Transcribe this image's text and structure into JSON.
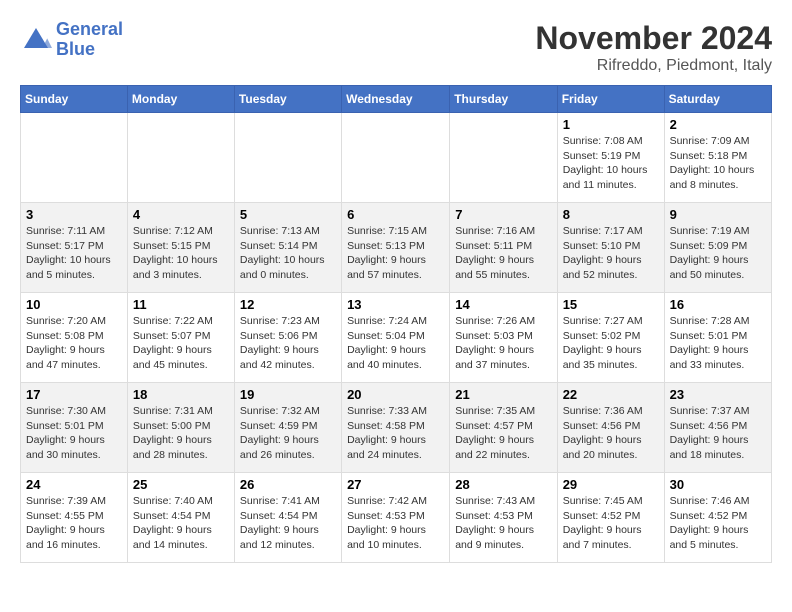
{
  "logo": {
    "line1": "General",
    "line2": "Blue"
  },
  "title": "November 2024",
  "subtitle": "Rifreddo, Piedmont, Italy",
  "days_of_week": [
    "Sunday",
    "Monday",
    "Tuesday",
    "Wednesday",
    "Thursday",
    "Friday",
    "Saturday"
  ],
  "weeks": [
    [
      {
        "day": "",
        "info": ""
      },
      {
        "day": "",
        "info": ""
      },
      {
        "day": "",
        "info": ""
      },
      {
        "day": "",
        "info": ""
      },
      {
        "day": "",
        "info": ""
      },
      {
        "day": "1",
        "info": "Sunrise: 7:08 AM\nSunset: 5:19 PM\nDaylight: 10 hours and 11 minutes."
      },
      {
        "day": "2",
        "info": "Sunrise: 7:09 AM\nSunset: 5:18 PM\nDaylight: 10 hours and 8 minutes."
      }
    ],
    [
      {
        "day": "3",
        "info": "Sunrise: 7:11 AM\nSunset: 5:17 PM\nDaylight: 10 hours and 5 minutes."
      },
      {
        "day": "4",
        "info": "Sunrise: 7:12 AM\nSunset: 5:15 PM\nDaylight: 10 hours and 3 minutes."
      },
      {
        "day": "5",
        "info": "Sunrise: 7:13 AM\nSunset: 5:14 PM\nDaylight: 10 hours and 0 minutes."
      },
      {
        "day": "6",
        "info": "Sunrise: 7:15 AM\nSunset: 5:13 PM\nDaylight: 9 hours and 57 minutes."
      },
      {
        "day": "7",
        "info": "Sunrise: 7:16 AM\nSunset: 5:11 PM\nDaylight: 9 hours and 55 minutes."
      },
      {
        "day": "8",
        "info": "Sunrise: 7:17 AM\nSunset: 5:10 PM\nDaylight: 9 hours and 52 minutes."
      },
      {
        "day": "9",
        "info": "Sunrise: 7:19 AM\nSunset: 5:09 PM\nDaylight: 9 hours and 50 minutes."
      }
    ],
    [
      {
        "day": "10",
        "info": "Sunrise: 7:20 AM\nSunset: 5:08 PM\nDaylight: 9 hours and 47 minutes."
      },
      {
        "day": "11",
        "info": "Sunrise: 7:22 AM\nSunset: 5:07 PM\nDaylight: 9 hours and 45 minutes."
      },
      {
        "day": "12",
        "info": "Sunrise: 7:23 AM\nSunset: 5:06 PM\nDaylight: 9 hours and 42 minutes."
      },
      {
        "day": "13",
        "info": "Sunrise: 7:24 AM\nSunset: 5:04 PM\nDaylight: 9 hours and 40 minutes."
      },
      {
        "day": "14",
        "info": "Sunrise: 7:26 AM\nSunset: 5:03 PM\nDaylight: 9 hours and 37 minutes."
      },
      {
        "day": "15",
        "info": "Sunrise: 7:27 AM\nSunset: 5:02 PM\nDaylight: 9 hours and 35 minutes."
      },
      {
        "day": "16",
        "info": "Sunrise: 7:28 AM\nSunset: 5:01 PM\nDaylight: 9 hours and 33 minutes."
      }
    ],
    [
      {
        "day": "17",
        "info": "Sunrise: 7:30 AM\nSunset: 5:01 PM\nDaylight: 9 hours and 30 minutes."
      },
      {
        "day": "18",
        "info": "Sunrise: 7:31 AM\nSunset: 5:00 PM\nDaylight: 9 hours and 28 minutes."
      },
      {
        "day": "19",
        "info": "Sunrise: 7:32 AM\nSunset: 4:59 PM\nDaylight: 9 hours and 26 minutes."
      },
      {
        "day": "20",
        "info": "Sunrise: 7:33 AM\nSunset: 4:58 PM\nDaylight: 9 hours and 24 minutes."
      },
      {
        "day": "21",
        "info": "Sunrise: 7:35 AM\nSunset: 4:57 PM\nDaylight: 9 hours and 22 minutes."
      },
      {
        "day": "22",
        "info": "Sunrise: 7:36 AM\nSunset: 4:56 PM\nDaylight: 9 hours and 20 minutes."
      },
      {
        "day": "23",
        "info": "Sunrise: 7:37 AM\nSunset: 4:56 PM\nDaylight: 9 hours and 18 minutes."
      }
    ],
    [
      {
        "day": "24",
        "info": "Sunrise: 7:39 AM\nSunset: 4:55 PM\nDaylight: 9 hours and 16 minutes."
      },
      {
        "day": "25",
        "info": "Sunrise: 7:40 AM\nSunset: 4:54 PM\nDaylight: 9 hours and 14 minutes."
      },
      {
        "day": "26",
        "info": "Sunrise: 7:41 AM\nSunset: 4:54 PM\nDaylight: 9 hours and 12 minutes."
      },
      {
        "day": "27",
        "info": "Sunrise: 7:42 AM\nSunset: 4:53 PM\nDaylight: 9 hours and 10 minutes."
      },
      {
        "day": "28",
        "info": "Sunrise: 7:43 AM\nSunset: 4:53 PM\nDaylight: 9 hours and 9 minutes."
      },
      {
        "day": "29",
        "info": "Sunrise: 7:45 AM\nSunset: 4:52 PM\nDaylight: 9 hours and 7 minutes."
      },
      {
        "day": "30",
        "info": "Sunrise: 7:46 AM\nSunset: 4:52 PM\nDaylight: 9 hours and 5 minutes."
      }
    ]
  ]
}
